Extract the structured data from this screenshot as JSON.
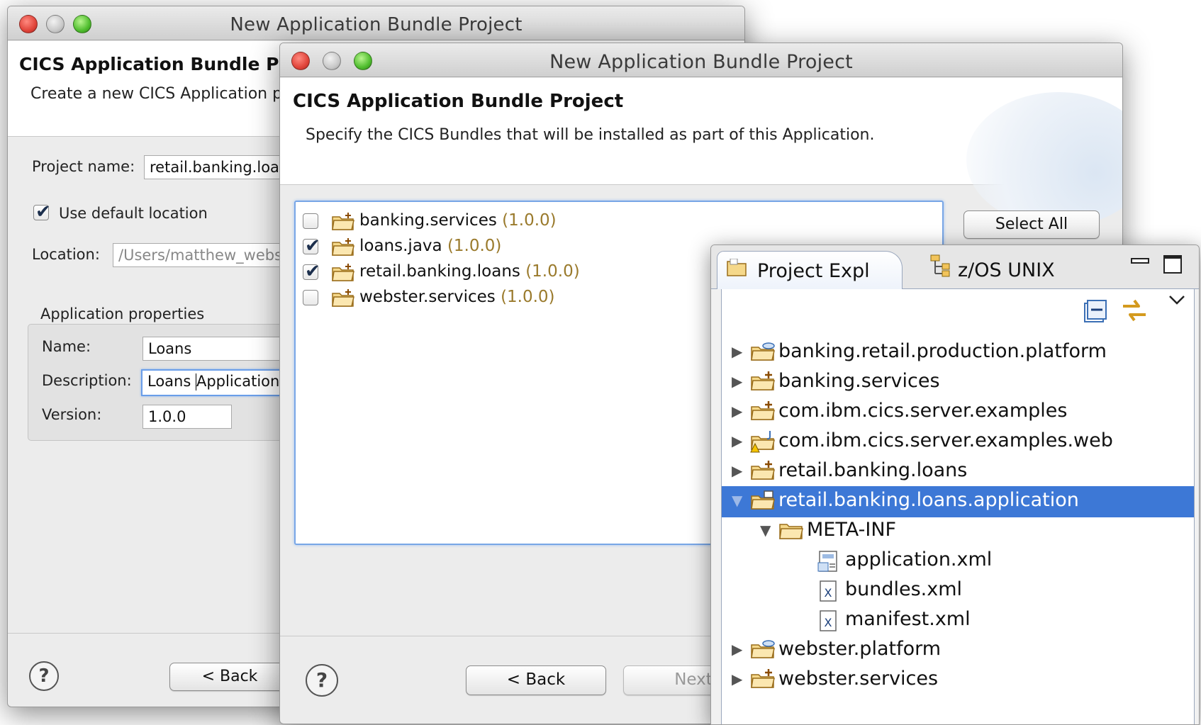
{
  "back_window": {
    "title": "New Application Bundle Project",
    "header_title": "CICS Application Bundle Project",
    "header_desc": "Create a new CICS Application project",
    "project_name_label": "Project name:",
    "project_name_value": "retail.banking.loans.application",
    "use_default_location_label": "Use default location",
    "use_default_location_checked": true,
    "location_label": "Location:",
    "location_value": "/Users/matthew_webster/workspace",
    "group_label": "Application properties",
    "name_label": "Name:",
    "name_value": "Loans",
    "description_label": "Description:",
    "description_value_before_cursor": "Loans ",
    "description_value_after_cursor": "Application",
    "version_label": "Version:",
    "version_value": "1.0.0",
    "back_label": "< Back",
    "help_label": "?"
  },
  "front_window": {
    "title": "New Application Bundle Project",
    "header_title": "CICS Application Bundle Project",
    "header_desc": "Specify the CICS Bundles that will be installed as part of this Application.",
    "select_all_label": "Select All",
    "bundles": [
      {
        "name": "banking.services",
        "version": "(1.0.0)",
        "checked": false
      },
      {
        "name": "loans.java",
        "version": "(1.0.0)",
        "checked": true
      },
      {
        "name": "retail.banking.loans",
        "version": "(1.0.0)",
        "checked": true
      },
      {
        "name": "webster.services",
        "version": "(1.0.0)",
        "checked": false
      }
    ],
    "back_label": "< Back",
    "next_label": "Next",
    "help_label": "?"
  },
  "explorer": {
    "tabs": [
      {
        "label": "Project Expl",
        "icon": "folder-icon",
        "active": true
      },
      {
        "label": "z/OS UNIX",
        "icon": "tree-icon",
        "active": false
      }
    ],
    "tree": [
      {
        "label": "banking.retail.production.platform",
        "depth": 0,
        "icon": "platform-project-icon",
        "expanded": false,
        "selected": false
      },
      {
        "label": "banking.services",
        "depth": 0,
        "icon": "bundle-project-icon",
        "expanded": false,
        "selected": false
      },
      {
        "label": "com.ibm.cics.server.examples",
        "depth": 0,
        "icon": "bundle-project-icon",
        "expanded": false,
        "selected": false
      },
      {
        "label": "com.ibm.cics.server.examples.web",
        "depth": 0,
        "icon": "java-project-warning-icon",
        "expanded": false,
        "selected": false
      },
      {
        "label": "retail.banking.loans",
        "depth": 0,
        "icon": "bundle-project-icon",
        "expanded": false,
        "selected": false
      },
      {
        "label": "retail.banking.loans.application",
        "depth": 0,
        "icon": "application-project-icon",
        "expanded": true,
        "selected": true
      },
      {
        "label": "META-INF",
        "depth": 1,
        "icon": "folder-icon",
        "expanded": true,
        "selected": false
      },
      {
        "label": "application.xml",
        "depth": 2,
        "icon": "application-xml-icon",
        "expanded": null,
        "selected": false
      },
      {
        "label": "bundles.xml",
        "depth": 2,
        "icon": "xml-file-icon",
        "expanded": null,
        "selected": false
      },
      {
        "label": "manifest.xml",
        "depth": 2,
        "icon": "xml-file-icon",
        "expanded": null,
        "selected": false
      },
      {
        "label": "webster.platform",
        "depth": 0,
        "icon": "platform-project-icon",
        "expanded": false,
        "selected": false
      },
      {
        "label": "webster.services",
        "depth": 0,
        "icon": "bundle-project-icon",
        "expanded": false,
        "selected": false
      }
    ],
    "colors": {
      "selection": "#3d78d6",
      "version": "#9a7a2c",
      "focus_ring": "#78a6e6"
    }
  }
}
